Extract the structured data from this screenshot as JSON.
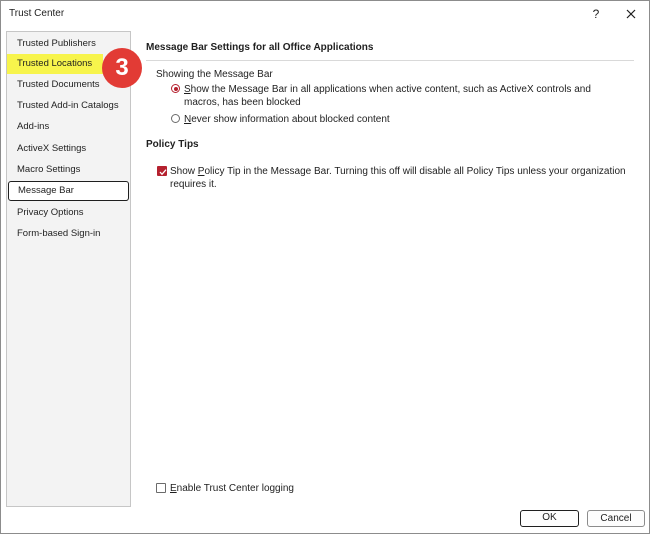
{
  "window": {
    "title": "Trust Center",
    "help_label": "?"
  },
  "sidebar": {
    "items": [
      {
        "label": "Trusted Publishers",
        "state": "normal"
      },
      {
        "label": "Trusted Locations",
        "state": "highlighted"
      },
      {
        "label": "Trusted Documents",
        "state": "normal"
      },
      {
        "label": "Trusted Add-in Catalogs",
        "state": "normal"
      },
      {
        "label": "Add-ins",
        "state": "normal"
      },
      {
        "label": "ActiveX Settings",
        "state": "normal"
      },
      {
        "label": "Macro Settings",
        "state": "normal"
      },
      {
        "label": "Message Bar",
        "state": "selected"
      },
      {
        "label": "Privacy Options",
        "state": "normal"
      },
      {
        "label": "Form-based Sign-in",
        "state": "normal"
      }
    ]
  },
  "callout": {
    "number": "3",
    "color": "#e23b35"
  },
  "main": {
    "message_bar_section": {
      "title": "Message Bar Settings for all Office Applications",
      "group_label": "Showing the Message Bar",
      "options": [
        {
          "key": "S",
          "rest": "how the Message Bar in all applications when active content, such as ActiveX controls and macros, has been blocked",
          "checked": true
        },
        {
          "key": "N",
          "rest": "ever show information about blocked content",
          "checked": false
        }
      ]
    },
    "policy_tips_section": {
      "title": "Policy Tips",
      "checkbox": {
        "pre": "Show ",
        "key": "P",
        "rest": "olicy Tip in the Message Bar. Turning this off will disable all Policy Tips unless your organization requires it.",
        "checked": true
      }
    },
    "logging": {
      "key": "E",
      "rest": "nable Trust Center logging",
      "checked": false
    }
  },
  "footer": {
    "ok_label": "OK",
    "cancel_label": "Cancel"
  },
  "colors": {
    "accent": "#b5212f",
    "highlight": "#f7f44c"
  }
}
